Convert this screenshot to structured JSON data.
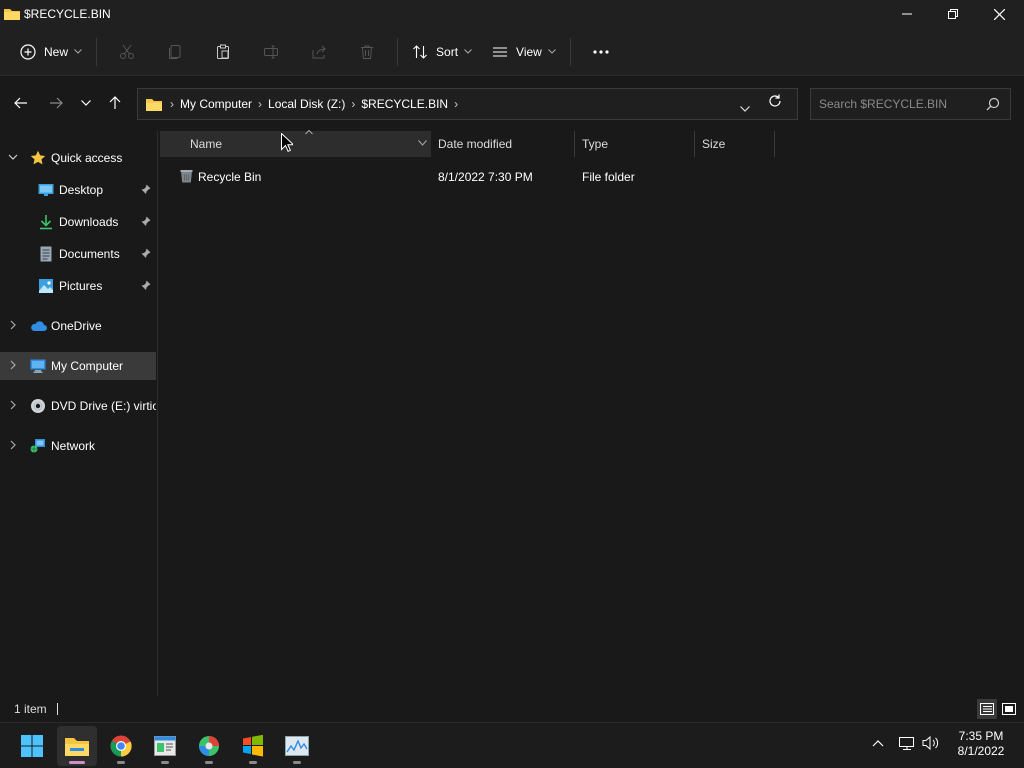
{
  "window": {
    "title": "$RECYCLE.BIN"
  },
  "commandbar": {
    "new_label": "New",
    "sort_label": "Sort",
    "view_label": "View"
  },
  "address": {
    "crumbs": [
      "My Computer",
      "Local Disk (Z:)",
      "$RECYCLE.BIN"
    ]
  },
  "search": {
    "placeholder": "Search $RECYCLE.BIN"
  },
  "sidebar": {
    "quick_access": "Quick access",
    "items": [
      {
        "label": "Desktop",
        "icon": "desktop-icon",
        "pinned": true
      },
      {
        "label": "Downloads",
        "icon": "downloads-icon",
        "pinned": true
      },
      {
        "label": "Documents",
        "icon": "documents-icon",
        "pinned": true
      },
      {
        "label": "Pictures",
        "icon": "pictures-icon",
        "pinned": true
      }
    ],
    "onedrive": "OneDrive",
    "my_computer": "My Computer",
    "dvd_drive": "DVD Drive (E:) virtio-",
    "network": "Network"
  },
  "columns": {
    "name": "Name",
    "date": "Date modified",
    "type": "Type",
    "size": "Size"
  },
  "files": [
    {
      "name": "Recycle Bin",
      "date": "8/1/2022 7:30 PM",
      "type": "File folder",
      "size": ""
    }
  ],
  "status": {
    "count": "1 item"
  },
  "taskbar": {
    "apps": [
      "windows-start-icon",
      "file-explorer-icon",
      "chrome-icon",
      "app-icon",
      "color-app-icon",
      "windows-logo-icon",
      "chart-app-icon"
    ],
    "time": "7:35 PM",
    "date": "8/1/2022"
  },
  "colors": {
    "background": "#191919",
    "chrome": "#202020",
    "selected": "#3a3a3a",
    "accent": "#0078d4",
    "folder": "#f4c542"
  }
}
